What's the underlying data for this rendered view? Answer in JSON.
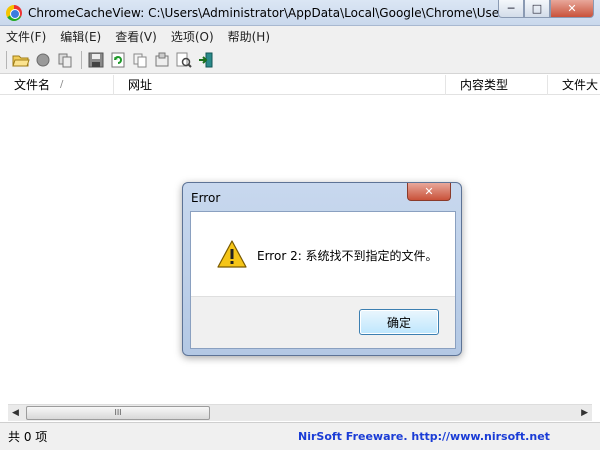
{
  "window": {
    "title": "ChromeCacheView:  C:\\Users\\Administrator\\AppData\\Local\\Google\\Chrome\\User D...",
    "minimize_glyph": "─",
    "maximize_glyph": "□",
    "close_glyph": "✕"
  },
  "menu": {
    "items": [
      "文件(F)",
      "编辑(E)",
      "查看(V)",
      "选项(O)",
      "帮助(H)"
    ]
  },
  "toolbar": {
    "icons": [
      "open-folder-icon",
      "stop-icon",
      "copy-files-icon",
      "save-icon",
      "refresh-icon",
      "copy-icon",
      "properties-icon",
      "find-icon",
      "exit-icon"
    ]
  },
  "list": {
    "columns": [
      "文件名",
      "网址",
      "内容类型",
      "文件大"
    ],
    "sort_indicator": "/"
  },
  "scrollbar": {
    "left_arrow": "◀",
    "right_arrow": "▶",
    "grip": "III"
  },
  "status": {
    "count": "共 0 项",
    "link": "NirSoft Freeware.  http://www.nirsoft.net",
    "link_color": "#1a3cd6"
  },
  "dialog": {
    "title": "Error",
    "message": "Error 2: 系统找不到指定的文件。",
    "ok_label": "确定",
    "close_glyph": "✕",
    "icon": "warning-icon"
  }
}
